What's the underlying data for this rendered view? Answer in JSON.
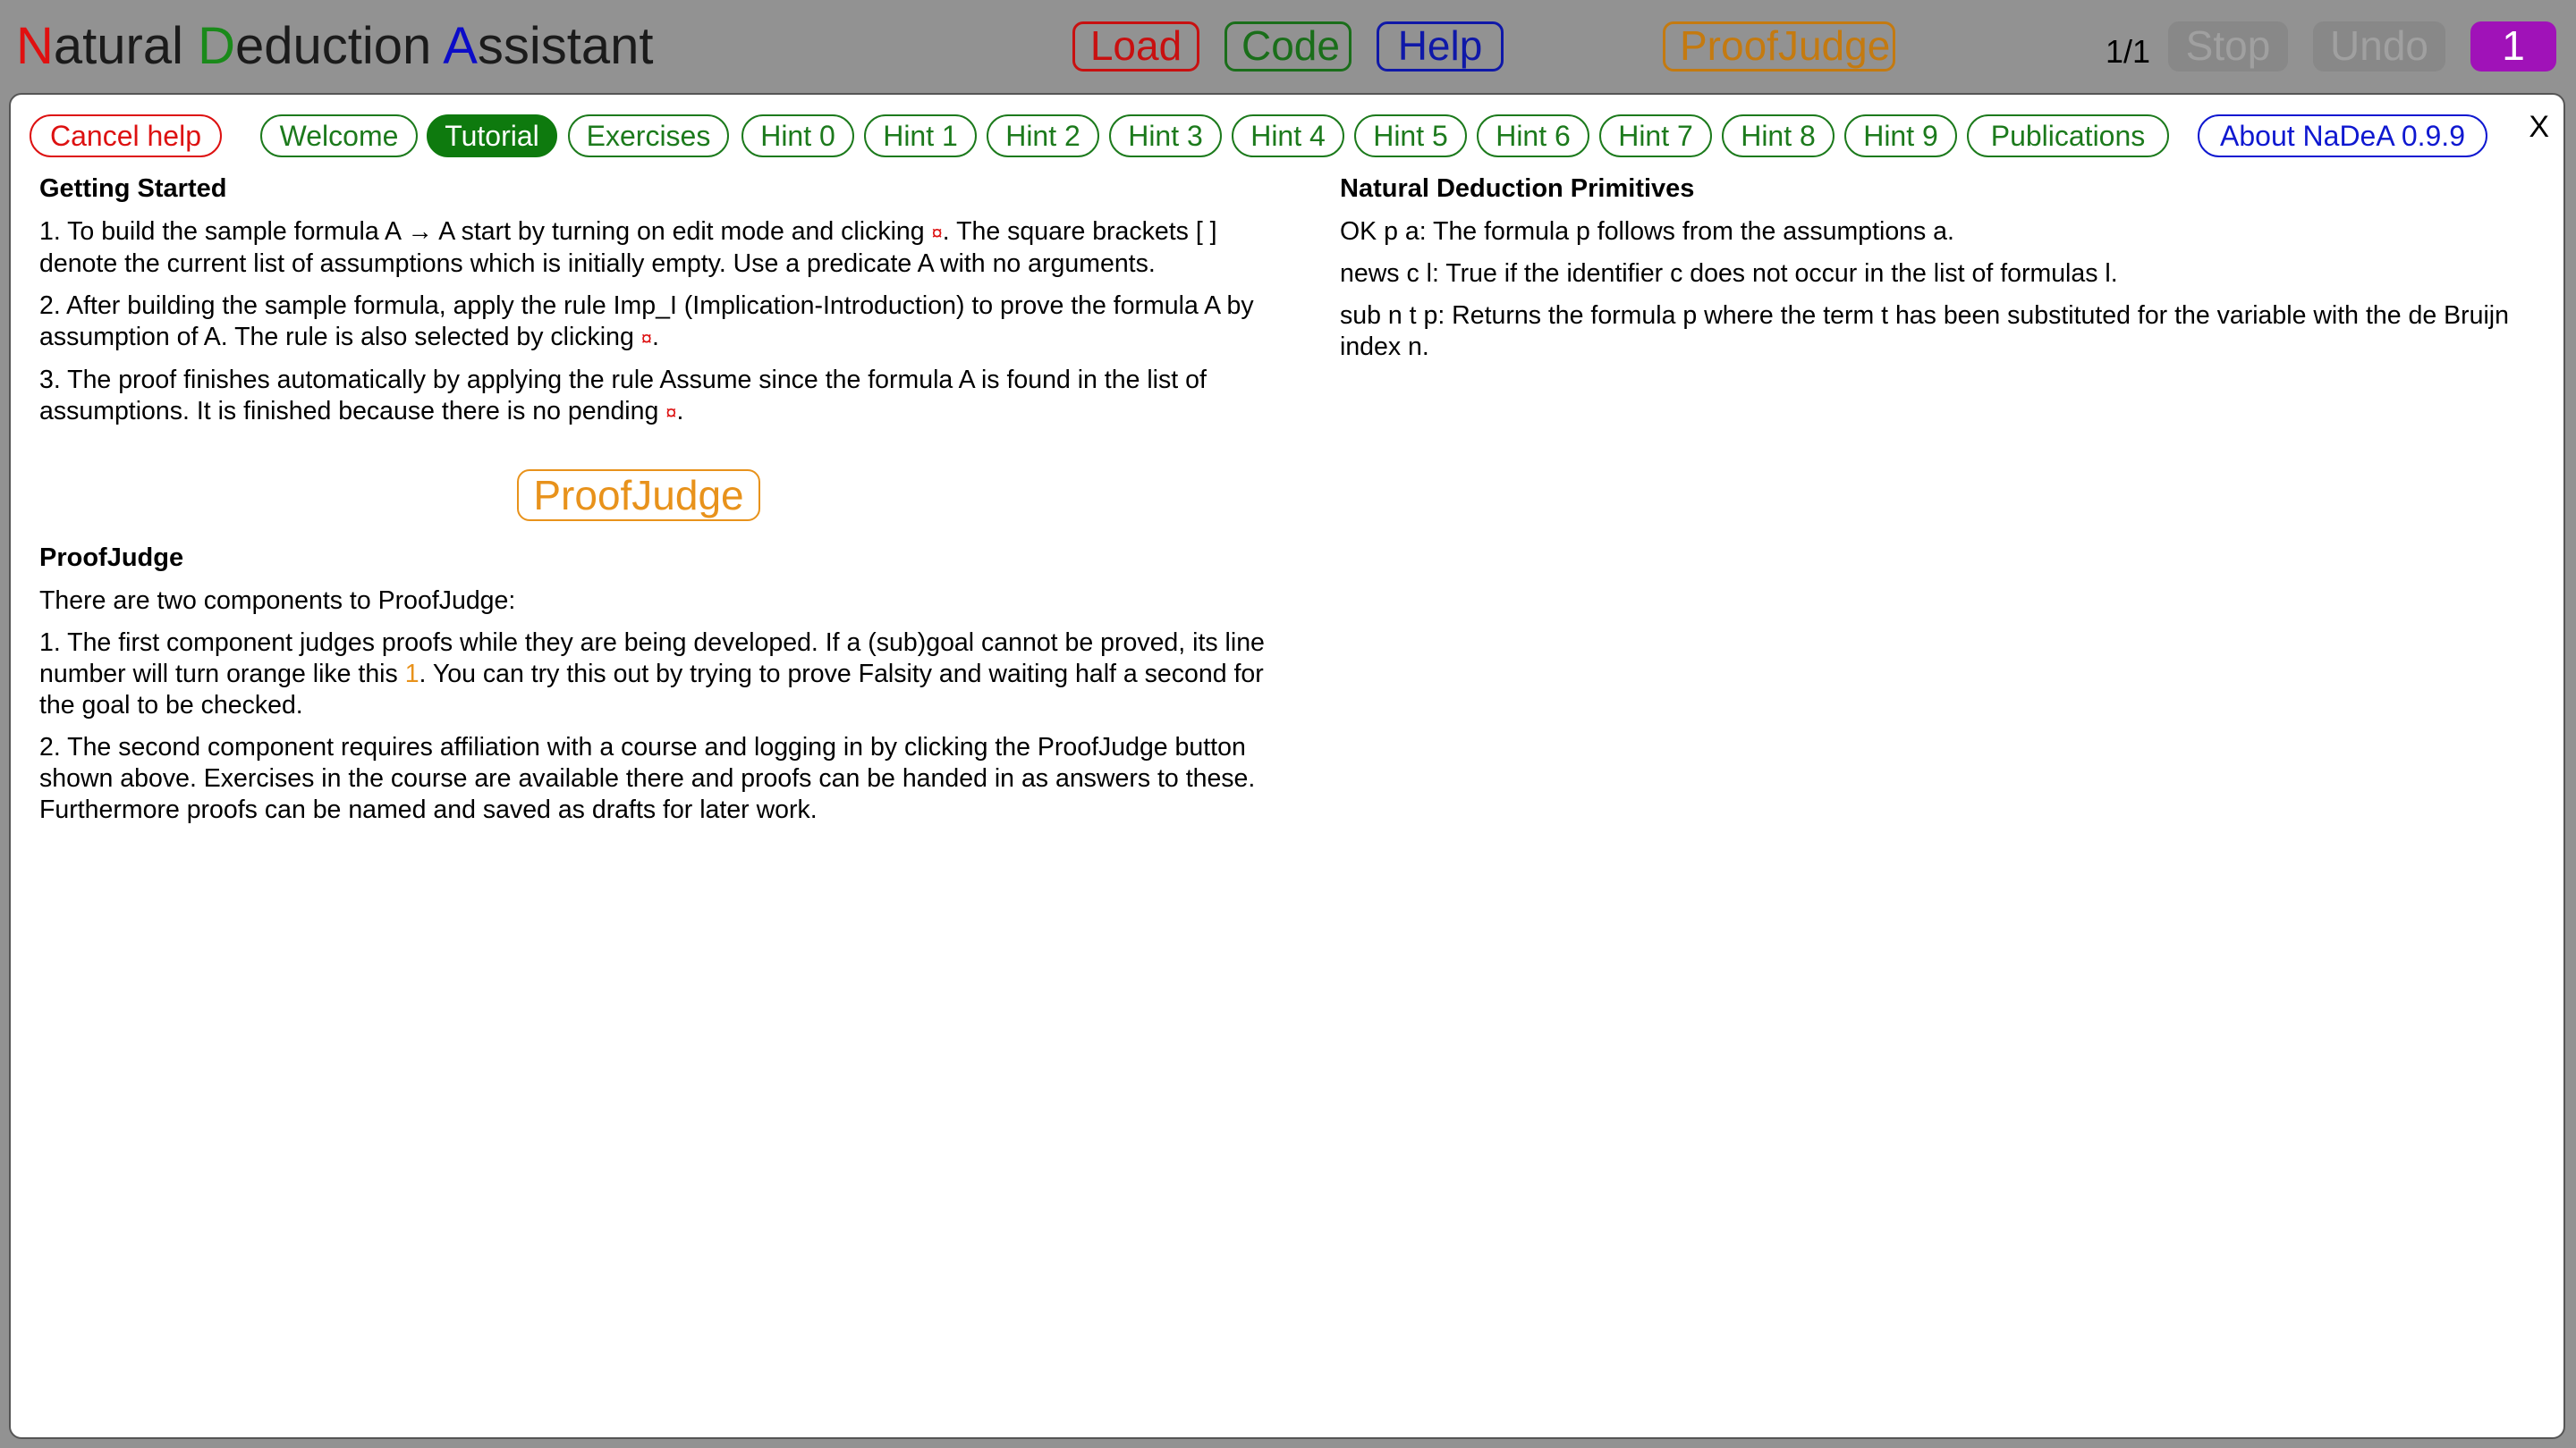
{
  "header": {
    "title": {
      "n": "N",
      "a": "atural ",
      "d": "D",
      "e": "eduction ",
      "as": "A",
      "ss": "ssistant"
    },
    "title_colors": [
      "#e01010",
      "#1a8a1a",
      "#0c0cc8"
    ],
    "buttons": {
      "load": "Load",
      "code": "Code",
      "help": "Help",
      "proofjudge": "ProofJudge"
    },
    "counter": "1/1",
    "stop": "Stop",
    "undo": "Undo",
    "one": "1"
  },
  "tabs": {
    "cancel_help": "Cancel help",
    "items": [
      "Welcome",
      "Tutorial",
      "Exercises",
      "Hint 0",
      "Hint 1",
      "Hint 2",
      "Hint 3",
      "Hint 4",
      "Hint 5",
      "Hint 6",
      "Hint 7",
      "Hint 8",
      "Hint 9",
      "Publications"
    ],
    "active": "Tutorial",
    "about": "About NaDeA 0.9.9",
    "close": "X"
  },
  "getting_started": {
    "heading": "Getting Started",
    "p1_a": "1. To build the sample formula A → A start by turning on edit mode and clicking ",
    "p1_b": ". The square brackets [ ] denote the current list of assumptions which is initially empty. Use a predicate A with no arguments.",
    "p2_a": "2. After building the sample formula, apply the rule Imp_I (Implication-Introduction) to prove the formula A by assumption of A. The rule is also selected by clicking ",
    "p2_b": ".",
    "p3_a": "3. The proof finishes automatically by applying the rule Assume since the formula A is found in the list of assumptions. It is finished because there is no pending ",
    "p3_b": ".",
    "symbol": "¤"
  },
  "proofjudge_button": "ProofJudge",
  "proofjudge": {
    "heading": "ProofJudge",
    "intro": "There are two components to ProofJudge:",
    "p1_a": "1. The first component judges proofs while they are being developed. If a (sub)goal cannot be proved, its line number will turn orange like this ",
    "p1_num": "1",
    "p1_b": ". You can try this out by trying to prove Falsity and waiting half a second for the goal to be checked.",
    "p2": "2. The second component requires affiliation with a course and logging in by clicking the ProofJudge button shown above. Exercises in the course are available there and proofs can be handed in as answers to these. Furthermore proofs can be named and saved as drafts for later work."
  },
  "primitives": {
    "heading": "Natural Deduction Primitives",
    "items": [
      "OK p a: The formula p follows from the assumptions a.",
      "news c l: True if the identifier c does not occur in the list of formulas l.",
      "sub n t p: Returns the formula p where the term t has been substituted for the variable with the de Bruijn index n."
    ]
  }
}
